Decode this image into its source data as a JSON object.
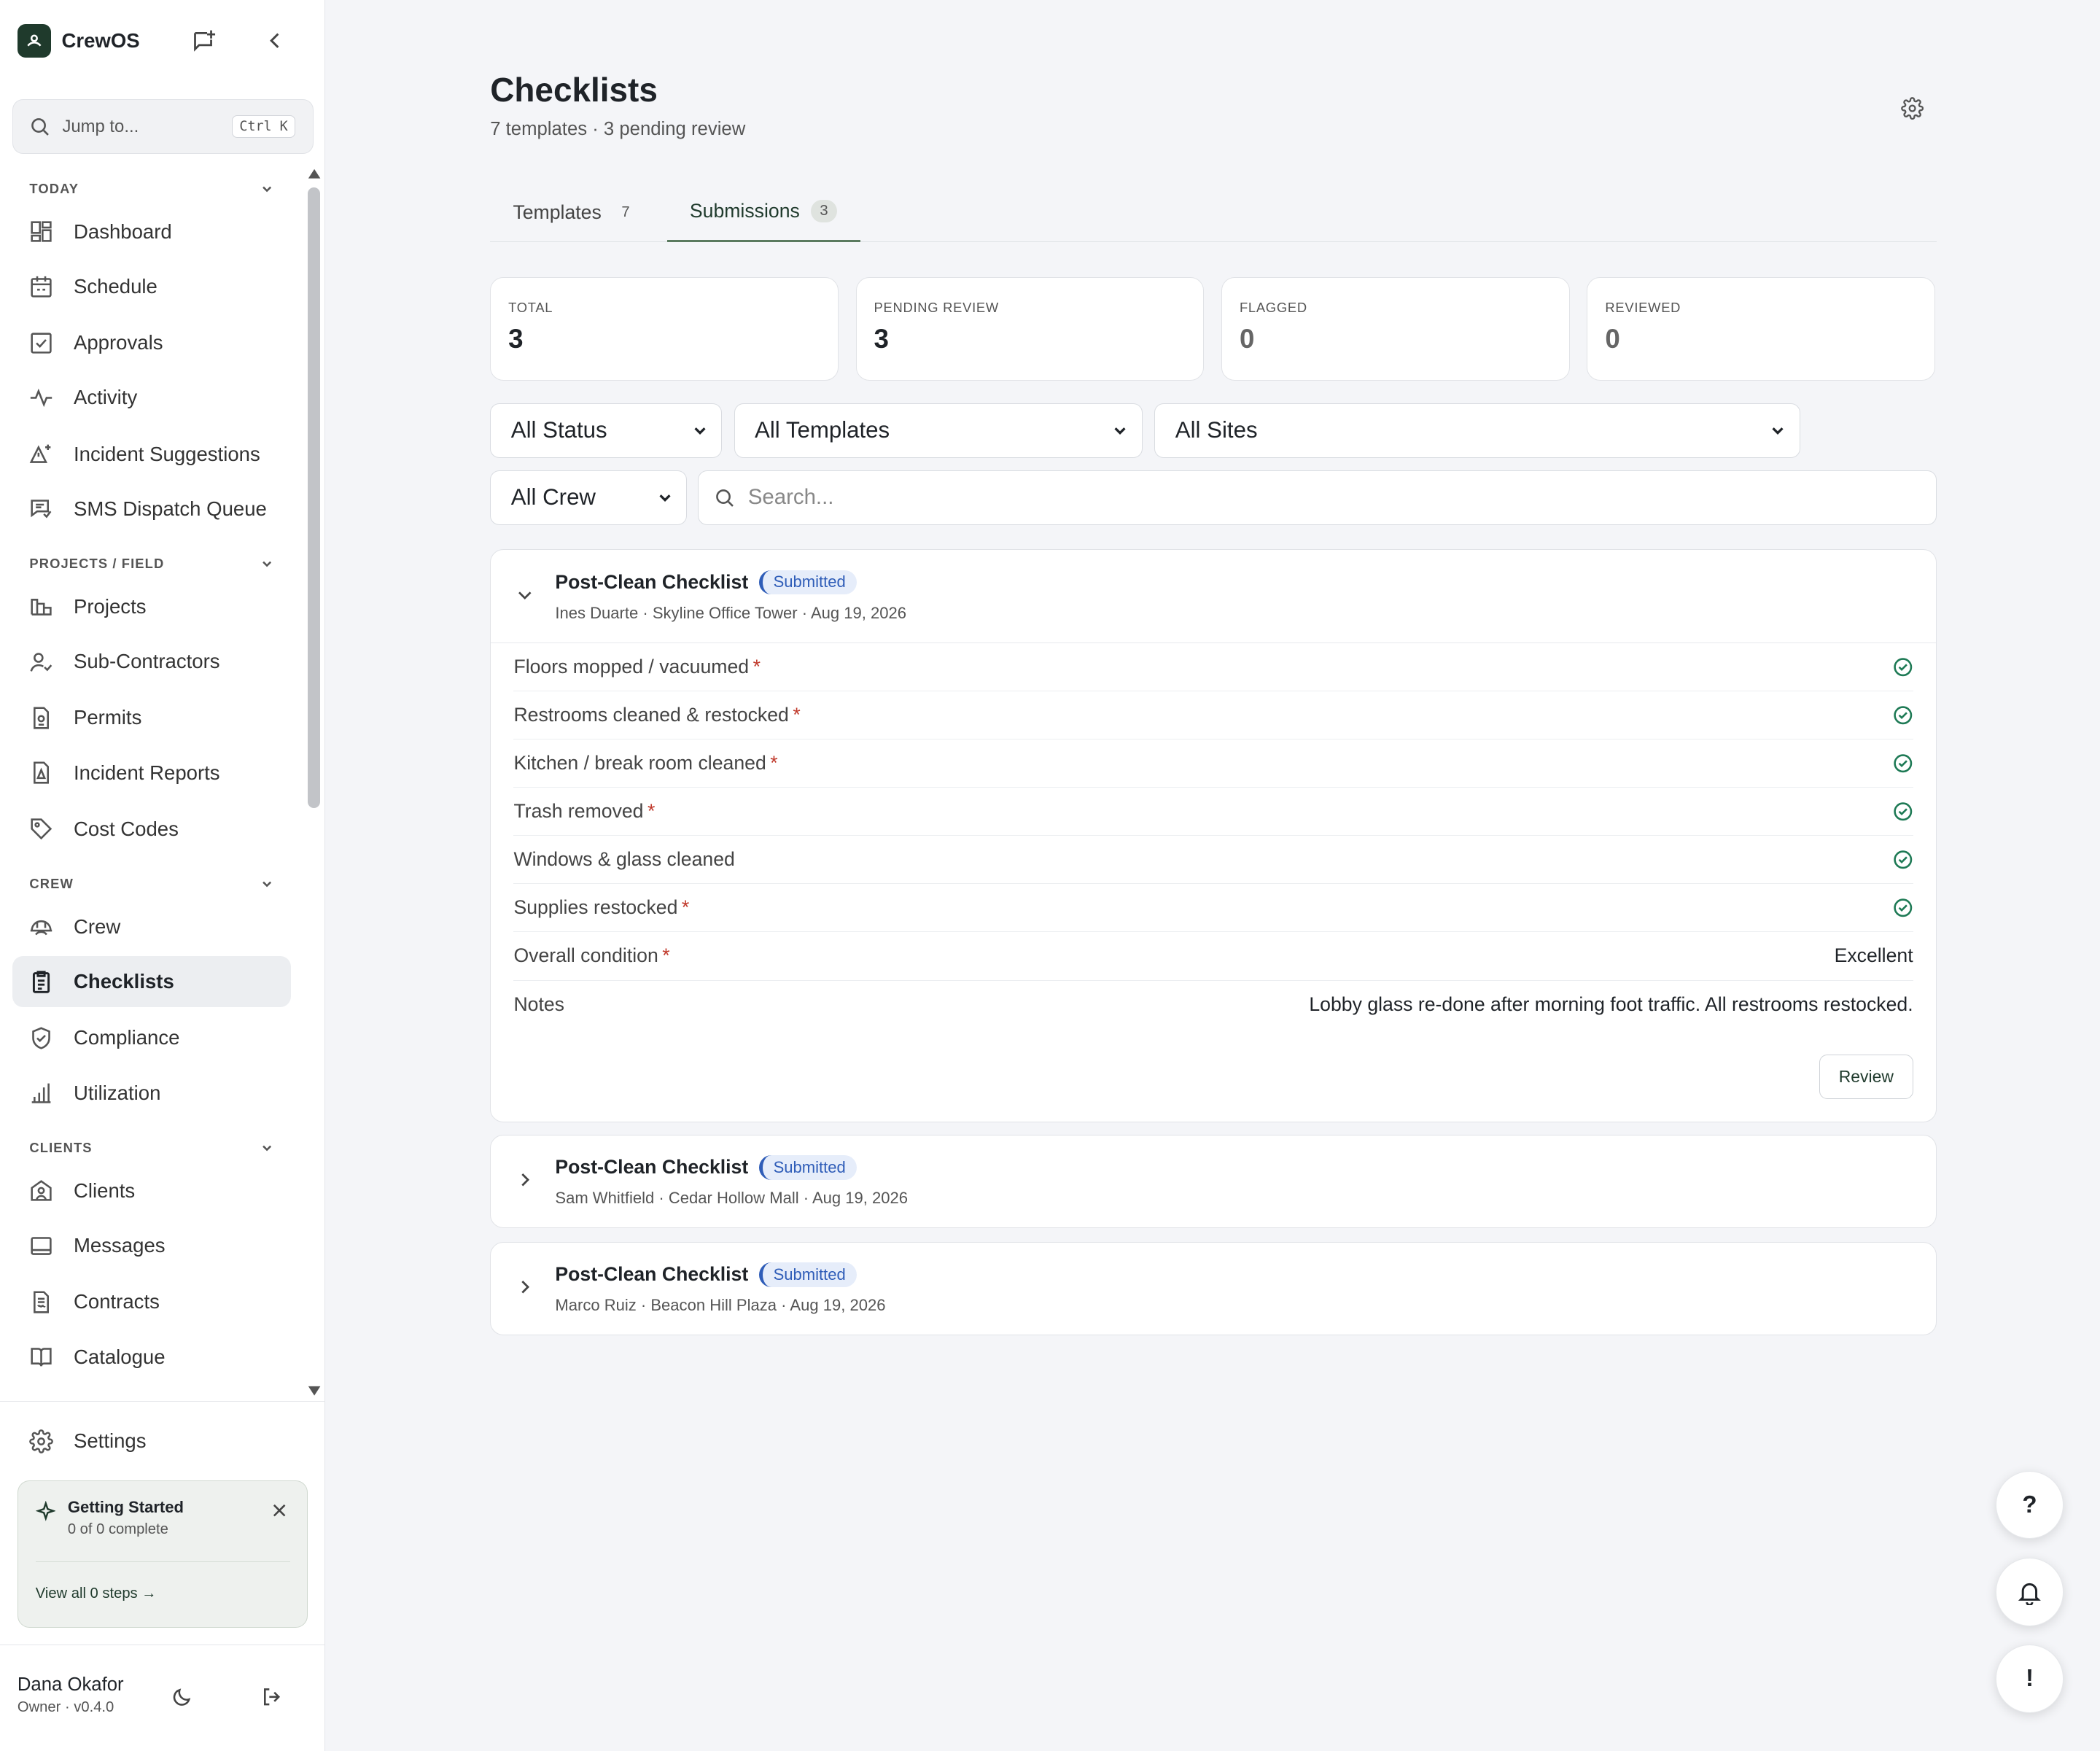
{
  "brand": {
    "name": "CrewOS"
  },
  "jump": {
    "placeholder": "Jump to...",
    "shortcut": "Ctrl K"
  },
  "sections": {
    "today": "TODAY",
    "projects": "PROJECTS / FIELD",
    "crew": "CREW",
    "clients": "CLIENTS"
  },
  "nav": {
    "dashboard": "Dashboard",
    "schedule": "Schedule",
    "approvals": "Approvals",
    "activity": "Activity",
    "incident_suggestions": "Incident Suggestions",
    "sms_dispatch": "SMS Dispatch Queue",
    "projects": "Projects",
    "subcontractors": "Sub-Contractors",
    "permits": "Permits",
    "incident_reports": "Incident Reports",
    "cost_codes": "Cost Codes",
    "crew": "Crew",
    "checklists": "Checklists",
    "compliance": "Compliance",
    "utilization": "Utilization",
    "clients": "Clients",
    "messages": "Messages",
    "contracts": "Contracts",
    "catalogue": "Catalogue",
    "settings": "Settings"
  },
  "getting_started": {
    "title": "Getting Started",
    "progress": "0 of 0 complete",
    "link": "View all 0 steps →"
  },
  "user": {
    "name": "Dana Okafor",
    "role": "Owner · v0.4.0"
  },
  "page": {
    "title": "Checklists",
    "subtitle": "7 templates · 3 pending review"
  },
  "tabs": [
    {
      "label": "Templates",
      "count": "7"
    },
    {
      "label": "Submissions",
      "count": "3"
    }
  ],
  "stats": [
    {
      "label": "TOTAL",
      "value": "3"
    },
    {
      "label": "PENDING REVIEW",
      "value": "3"
    },
    {
      "label": "FLAGGED",
      "value": "0"
    },
    {
      "label": "REVIEWED",
      "value": "0"
    }
  ],
  "filters": {
    "status": "All Status",
    "templates": "All Templates",
    "sites": "All Sites",
    "crew": "All Crew",
    "search_placeholder": "Search..."
  },
  "submissions": [
    {
      "title": "Post-Clean Checklist",
      "status": "Submitted",
      "meta": "Ines Duarte · Skyline Office Tower · Aug 19, 2026",
      "items": [
        {
          "label": "Floors mopped / vacuumed",
          "required": "*"
        },
        {
          "label": "Restrooms cleaned & restocked",
          "required": "*"
        },
        {
          "label": "Kitchen / break room cleaned",
          "required": "*"
        },
        {
          "label": "Trash removed",
          "required": "*"
        },
        {
          "label": "Windows & glass cleaned",
          "required": ""
        },
        {
          "label": "Supplies restocked",
          "required": "*"
        }
      ],
      "condition_label": "Overall condition",
      "condition_required": "*",
      "condition_value": "Excellent",
      "notes_label": "Notes",
      "notes_value": "Lobby glass re-done after morning foot traffic. All restrooms restocked.",
      "review_label": "Review"
    },
    {
      "title": "Post-Clean Checklist",
      "status": "Submitted",
      "meta": "Sam Whitfield · Cedar Hollow Mall · Aug 19, 2026"
    },
    {
      "title": "Post-Clean Checklist",
      "status": "Submitted",
      "meta": "Marco Ruiz · Beacon Hill Plaza · Aug 19, 2026"
    }
  ],
  "fabs": {
    "help": "?",
    "alert": "!"
  },
  "colors": {
    "accent": "#1f3a2c",
    "badge": "#2f5db8",
    "check": "#1e7a55"
  }
}
